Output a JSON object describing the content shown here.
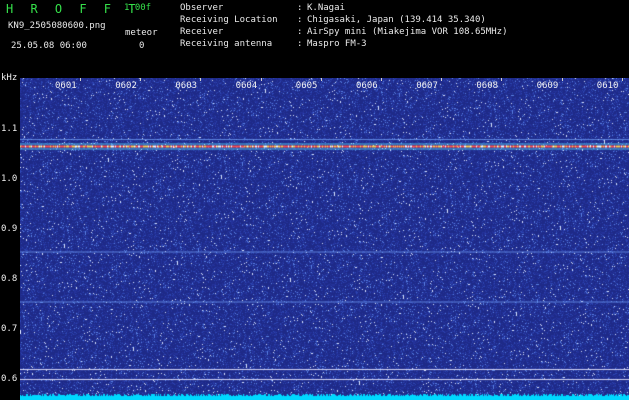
{
  "header": {
    "app_title": "H R O F F T",
    "version": "1.00f",
    "filename": "KN9_2505080600.png",
    "meteor_label": "meteor",
    "datetime": "25.05.08 06:00",
    "meteor_count": "0"
  },
  "info": [
    {
      "label": "Observer",
      "value": "K.Nagai"
    },
    {
      "label": "Receiving Location",
      "value": "Chigasaki, Japan (139.414 35.340)"
    },
    {
      "label": "Receiver",
      "value": "AirSpy mini (Miakejima VOR 108.65MHz)"
    },
    {
      "label": "Receiving antenna",
      "value": "Maspro FM-3"
    }
  ],
  "spectrogram": {
    "y_unit": "kHz",
    "y_ticks": [
      "1.1",
      "1.0",
      "0.9",
      "0.8",
      "0.7",
      "0.6"
    ],
    "x_ticks": [
      "0601",
      "0602",
      "0603",
      "0604",
      "0605",
      "0606",
      "0607",
      "0608",
      "0609",
      "0610"
    ],
    "background_color": "#1e2a88",
    "carrier_khz": 1.065,
    "colors": {
      "noise": "#2a3aa8",
      "bright": "#ffffff",
      "carrier": "#ff4a4a",
      "floor": "#00d8ff"
    }
  }
}
